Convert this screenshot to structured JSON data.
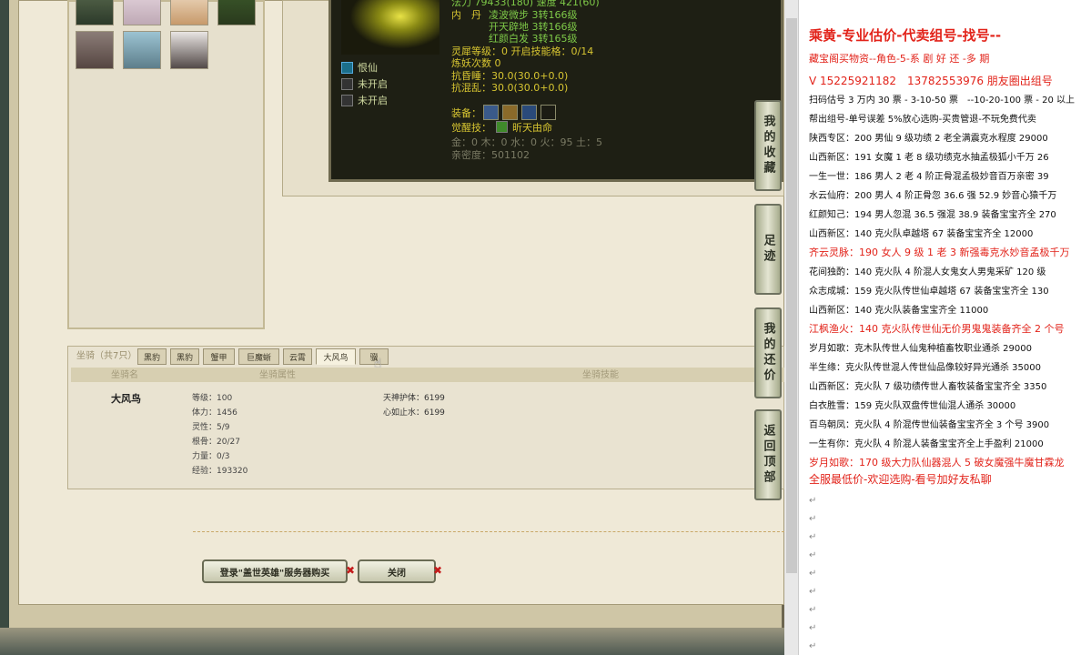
{
  "pet": {
    "stats_line": "法力 79433(180) 速度 421(60)",
    "neidan_label": "内　丹",
    "neidan": [
      "凌波微步 3转166级",
      "开天辟地 3转166级",
      "红颜白发 3转165级"
    ],
    "spirit_line": "灵犀等级：0 开启技能格：0/14",
    "refine_line": "炼妖次数 0",
    "resist1": "抗昏睡：30.0(30.0+0.0)",
    "resist2": "抗混乱：30.0(30.0+0.0)",
    "skills": [
      "恨仙",
      "未开启",
      "未开启"
    ],
    "equip_label": "装备：",
    "awaken_label": "觉醒技：",
    "awaken_skill": "昕天由命",
    "elements": "金：0 木：0 水：0 火：95 土：5",
    "intimacy": "亲密度：501102"
  },
  "mount": {
    "section_label": "坐骑（共7只）",
    "tabs": [
      "黑豹",
      "黑豹",
      "蟹甲",
      "巨魔蜥",
      "云霄",
      "大风鸟",
      "骥"
    ],
    "headers": [
      "坐骑名",
      "坐骑属性",
      "坐骑技能"
    ],
    "name": "大风鸟",
    "attrs": [
      "等级：100",
      "体力：1456",
      "灵性：5/9",
      "根骨：20/27",
      "力量：0/3",
      "经验：193320"
    ],
    "skills": [
      "天神护体：6199",
      "心如止水：6199"
    ]
  },
  "side_buttons": [
    "我的收藏",
    "足迹",
    "我的还价",
    "返回顶部"
  ],
  "buttons": {
    "buy": "登录\"盖世英雄\"服务器购买",
    "close": "关闭"
  },
  "doc": {
    "lines": [
      {
        "text": "乘黄-专业估价-代卖组号-找号--",
        "style": "title"
      },
      {
        "text": "藏宝阁买物资--角色-5-系  剧  好  还  -多  期",
        "style": "red"
      },
      {
        "text": "V 15225921182　13782553976 朋友圈出组号",
        "style": "redbig"
      },
      {
        "text": "扫码估号 3 万内 30 票 - 3-10-50 票　--10-20-100 票 - 20 以上",
        "style": ""
      },
      {
        "text": "帮出组号-单号误差 5%放心选购-买贵管退-不玩免费代卖",
        "style": ""
      },
      {
        "text": "陕西专区：200 男仙 9 级功绩 2 老全满震克水程度 29000",
        "style": ""
      },
      {
        "text": "山西新区：191 女魔 1 老 8 级功绩克水抽孟极狐小千万 26",
        "style": ""
      },
      {
        "text": "一生一世：186 男人 2 老 4 阶正骨混孟极妙音百万亲密 39",
        "style": ""
      },
      {
        "text": "水云仙府：200 男人 4 阶正骨忽 36.6 强 52.9 妙音心猿千万",
        "style": ""
      },
      {
        "text": "红颜知己：194 男人忽混 36.5 强混 38.9 装备宝宝齐全 270",
        "style": ""
      },
      {
        "text": "山西新区：140 克火队卓越塔 67 装备宝宝齐全 12000",
        "style": ""
      },
      {
        "text": "齐云灵脉：190 女人 9 级 1 老 3 新强毒克水妙音孟极千万",
        "style": "red"
      },
      {
        "text": "花间独酌：140 克火队 4 阶混人女鬼女人男鬼采矿 120 级",
        "style": ""
      },
      {
        "text": "众志成城：159 克火队传世仙卓越塔 67 装备宝宝齐全 130",
        "style": ""
      },
      {
        "text": "山西新区：140 克火队装备宝宝齐全 11000",
        "style": ""
      },
      {
        "text": "江枫渔火：140 克火队传世仙无价男鬼鬼装备齐全 2 个号",
        "style": "red"
      },
      {
        "text": "岁月如歌：克木队传世人仙鬼种植畜牧职业通杀 29000",
        "style": ""
      },
      {
        "text": "半生缘：克火队传世混人传世仙品像较好异光通杀 35000",
        "style": ""
      },
      {
        "text": "山西新区：克火队 7 级功绩传世人畜牧装备宝宝齐全 3350",
        "style": ""
      },
      {
        "text": "白衣胜雪：159 克火队双盘传世仙混人通杀 30000",
        "style": ""
      },
      {
        "text": "百鸟朝凤：克火队 4 阶混传世仙装备宝宝齐全 3 个号 3900",
        "style": ""
      },
      {
        "text": "一生有你：克火队 4 阶混人装备宝宝齐全上手盈利 21000",
        "style": ""
      },
      {
        "text": "岁月如歌：170 级大力队仙器混人 5 破女魔强牛魔甘霖龙",
        "style": "red"
      },
      {
        "text": "全服最低价-欢迎选购-看号加好友私聊",
        "style": "redbig"
      }
    ],
    "para_mark": "↵"
  },
  "colors": {
    "red": "#e2231a",
    "green": "#7ec948",
    "yellow": "#d7c531"
  }
}
